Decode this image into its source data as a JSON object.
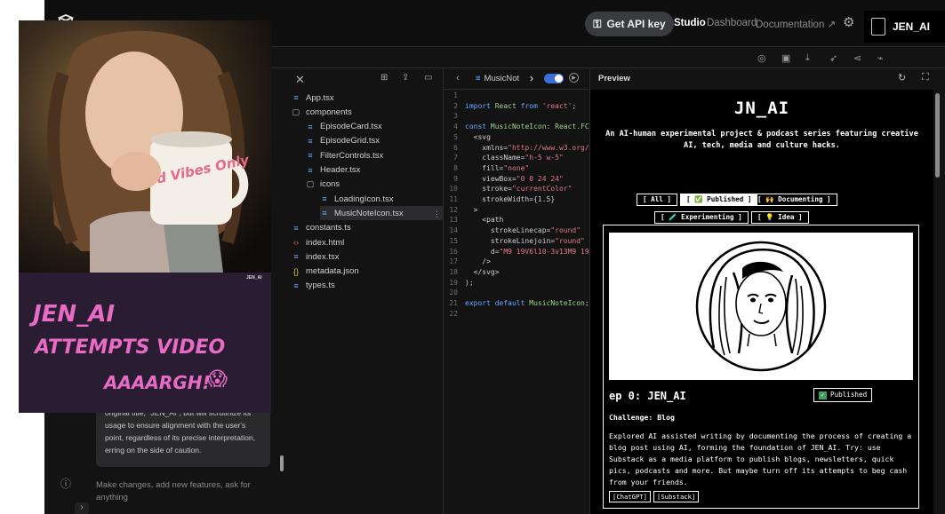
{
  "topbar": {
    "api_key_label": "Get API key",
    "nav_studio": "Studio",
    "nav_dashboard": "Dashboard",
    "nav_documentation": "Documentation",
    "username": "JEN_AI"
  },
  "chat": {
    "message_text": "original title, \"JEN_AI\", but will scrutinize its usage to ensure alignment with the user's point, regardless of its precise interpretation, erring on the side of caution.",
    "input_placeholder": "Make changes, add new features, ask for anything"
  },
  "files": [
    {
      "name": "App.tsx",
      "type": "ts",
      "indent": 0
    },
    {
      "name": "components",
      "type": "folder",
      "indent": 0
    },
    {
      "name": "EpisodeCard.tsx",
      "type": "ts",
      "indent": 1
    },
    {
      "name": "EpisodeGrid.tsx",
      "type": "ts",
      "indent": 1
    },
    {
      "name": "FilterControls.tsx",
      "type": "ts",
      "indent": 1
    },
    {
      "name": "Header.tsx",
      "type": "ts",
      "indent": 1
    },
    {
      "name": "icons",
      "type": "folder",
      "indent": 1
    },
    {
      "name": "LoadingIcon.tsx",
      "type": "ts",
      "indent": 2
    },
    {
      "name": "MusicNoteIcon.tsx",
      "type": "ts",
      "indent": 2,
      "selected": true
    },
    {
      "name": "constants.ts",
      "type": "ts",
      "indent": 0
    },
    {
      "name": "index.html",
      "type": "html",
      "indent": 0
    },
    {
      "name": "index.tsx",
      "type": "ts",
      "indent": 0
    },
    {
      "name": "metadata.json",
      "type": "json",
      "indent": 0
    },
    {
      "name": "types.ts",
      "type": "ts",
      "indent": 0
    }
  ],
  "editor": {
    "tab_label": "MusicNot",
    "lines": [
      {
        "n": "1",
        "parts": []
      },
      {
        "n": "2",
        "parts": [
          [
            "kw",
            "import "
          ],
          [
            "id",
            "React "
          ],
          [
            "kw",
            "from "
          ],
          [
            "str",
            "'react'"
          ],
          [
            "def",
            ";"
          ]
        ]
      },
      {
        "n": "3",
        "parts": []
      },
      {
        "n": "4",
        "parts": [
          [
            "kw",
            "const "
          ],
          [
            "id",
            "MusicNoteIcon"
          ],
          [
            "def",
            ": "
          ],
          [
            "id",
            "React.FC"
          ]
        ]
      },
      {
        "n": "5",
        "parts": [
          [
            "def",
            "  <svg"
          ]
        ]
      },
      {
        "n": "6",
        "parts": [
          [
            "def",
            "    xmlns="
          ],
          [
            "str",
            "\"http://www.w3.org/"
          ]
        ]
      },
      {
        "n": "7",
        "parts": [
          [
            "def",
            "    className="
          ],
          [
            "str",
            "\"h-5 w-5\""
          ]
        ]
      },
      {
        "n": "8",
        "parts": [
          [
            "def",
            "    fill="
          ],
          [
            "str",
            "\"none\""
          ]
        ]
      },
      {
        "n": "9",
        "parts": [
          [
            "def",
            "    viewBox="
          ],
          [
            "str",
            "\"0 0 24 24\""
          ]
        ]
      },
      {
        "n": "10",
        "parts": [
          [
            "def",
            "    stroke="
          ],
          [
            "str",
            "\"currentColor\""
          ]
        ]
      },
      {
        "n": "11",
        "parts": [
          [
            "def",
            "    strokeWidth={1.5}"
          ]
        ]
      },
      {
        "n": "12",
        "parts": [
          [
            "def",
            "  >"
          ]
        ]
      },
      {
        "n": "13",
        "parts": [
          [
            "def",
            "    <path"
          ]
        ]
      },
      {
        "n": "14",
        "parts": [
          [
            "def",
            "      strokeLinecap="
          ],
          [
            "str",
            "\"round\""
          ]
        ]
      },
      {
        "n": "15",
        "parts": [
          [
            "def",
            "      strokeLinejoin="
          ],
          [
            "str",
            "\"round\""
          ]
        ]
      },
      {
        "n": "16",
        "parts": [
          [
            "def",
            "      d="
          ],
          [
            "str",
            "\"M9 19V6l10-3v13M9 19"
          ]
        ]
      },
      {
        "n": "17",
        "parts": [
          [
            "def",
            "    />"
          ]
        ]
      },
      {
        "n": "18",
        "parts": [
          [
            "def",
            "  </svg>"
          ]
        ]
      },
      {
        "n": "19",
        "parts": [
          [
            "def",
            ");"
          ]
        ]
      },
      {
        "n": "20",
        "parts": []
      },
      {
        "n": "21",
        "parts": [
          [
            "kw",
            "export default "
          ],
          [
            "id",
            "MusicNoteIcon"
          ],
          [
            "def",
            ";"
          ]
        ]
      },
      {
        "n": "22",
        "parts": []
      }
    ]
  },
  "preview": {
    "header_label": "Preview",
    "site_title": "JN_AI",
    "subtitle": "An AI-human experimental project & podcast series featuring creative AI, tech, media and culture hacks.",
    "filters": [
      {
        "label": "[ All ]",
        "active": false
      },
      {
        "label": "[ ✅ Published ]",
        "active": true
      },
      {
        "label": "[ 🙌 Documenting ]",
        "active": false
      },
      {
        "label": "[ 🧪 Experimenting ]",
        "active": false
      },
      {
        "label": "[ 💡 Idea ]",
        "active": false
      }
    ],
    "card": {
      "title": "ep 0: JEN_AI",
      "status": "Published",
      "challenge": "Challenge: Blog",
      "description": "Explored AI assisted writing by documenting the process of creating a blog post using AI, forming the foundation of JEN_AI. Try: use Substack as a media platform to publish blogs, newsletters, quick pics, podcasts and more. But maybe turn off its attempts to beg cash from your friends.",
      "tags": [
        "[ChatGPT]",
        "[Substack]"
      ]
    }
  },
  "video": {
    "watermark": "JEN_AI",
    "mug_text": "Good Vibes Only",
    "caption_line1": "JEN_AI",
    "caption_line2": "ATTEMPTS VIDEO",
    "caption_line3": "AAAARGH!",
    "caption_emoji": "😱"
  },
  "colors": {
    "accent_pink": "#e86bc4",
    "toggle_blue": "#3b6fd8",
    "published_green": "#3aa15a"
  }
}
